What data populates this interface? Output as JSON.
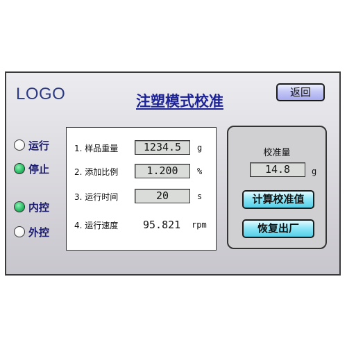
{
  "header": {
    "logo_text": "LOGO",
    "title": "注塑模式校准",
    "back_button_label": "返回"
  },
  "indicators": [
    {
      "label": "运行",
      "state": "off"
    },
    {
      "label": "停止",
      "state": "on"
    },
    {
      "label": "内控",
      "state": "on"
    },
    {
      "label": "外控",
      "state": "off"
    }
  ],
  "parameters": {
    "sample_weight": {
      "label": "1. 样品重量",
      "value": "1234.5",
      "unit": "g"
    },
    "add_ratio": {
      "label": "2. 添加比例",
      "value": "1.200",
      "unit": "%"
    },
    "run_time": {
      "label": "3. 运行时间",
      "value": "20",
      "unit": "s"
    },
    "run_speed": {
      "label": "4. 运行速度",
      "value": "95.821",
      "unit": "rpm"
    }
  },
  "calibration": {
    "label": "校准量",
    "value": "14.8",
    "unit": "g",
    "calc_button_label": "计算校准值",
    "reset_button_label": "恢复出厂"
  },
  "colors": {
    "indicator_on": "#2fbf6a",
    "indicator_off": "#f6f6f6",
    "title": "#1d2396",
    "action_button": "#8fe6f6",
    "back_button": "#c4c7f5"
  }
}
